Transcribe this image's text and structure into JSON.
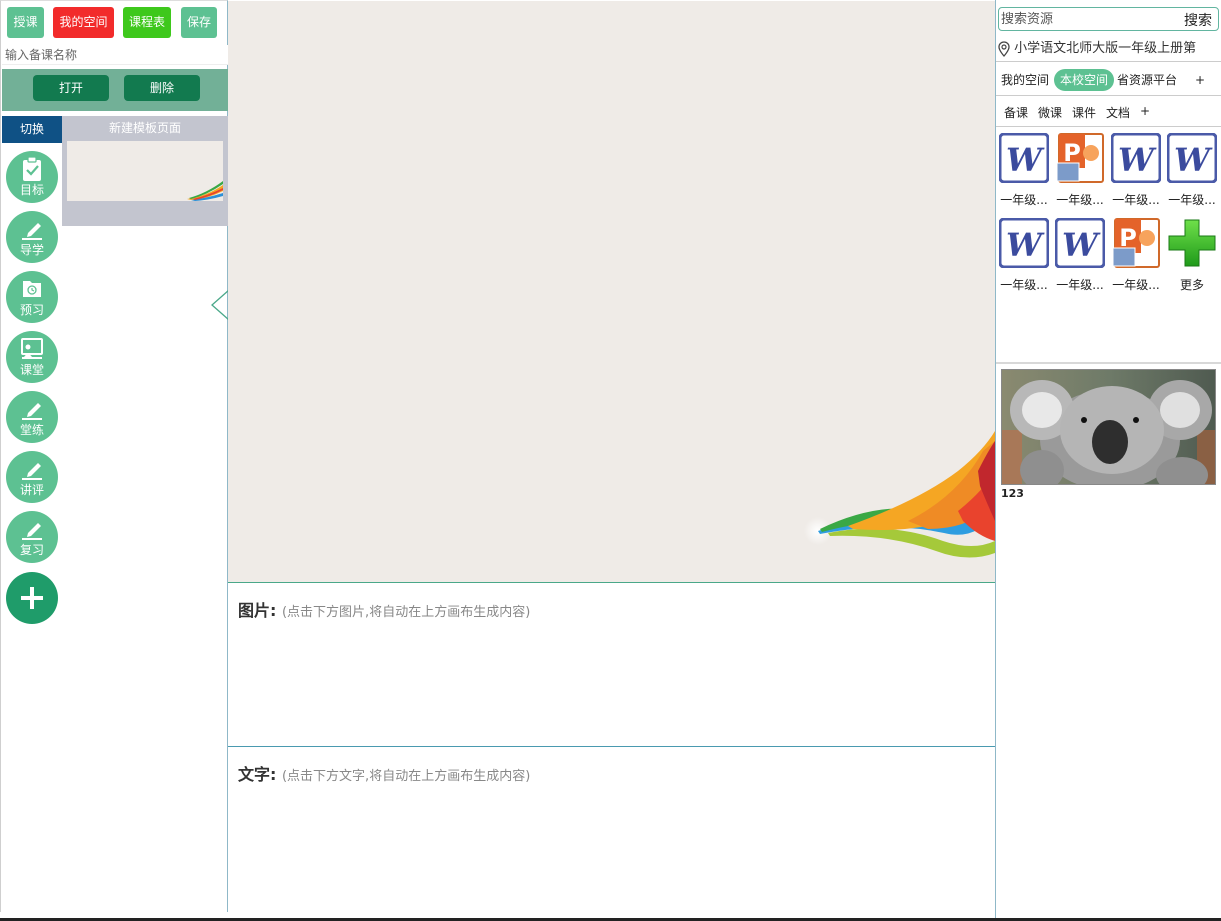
{
  "left": {
    "buttons": {
      "teach": "授课",
      "my_space": "我的空间",
      "schedule": "课程表",
      "save": "保存"
    },
    "button_colors": {
      "teach": "#5dc192",
      "my_space": "#f22b2b",
      "schedule": "#3ec81c",
      "save": "#5dc192"
    },
    "name_placeholder": "输入备课名称",
    "open": "打开",
    "delete": "删除",
    "switch": "切换",
    "template_title": "新建模板页面",
    "steps": [
      {
        "label": "目标",
        "icon": "clipboard-check-icon"
      },
      {
        "label": "导学",
        "icon": "pen-edit-icon"
      },
      {
        "label": "预习",
        "icon": "history-folder-icon"
      },
      {
        "label": "课堂",
        "icon": "classroom-board-icon"
      },
      {
        "label": "堂练",
        "icon": "pen-edit-icon"
      },
      {
        "label": "讲评",
        "icon": "pen-edit-icon"
      },
      {
        "label": "复习",
        "icon": "pen-edit-icon"
      }
    ]
  },
  "center": {
    "image_title": "图片:",
    "image_hint": "(点击下方图片,将自动在上方画布生成内容)",
    "text_title": "文字:",
    "text_hint": "(点击下方文字,将自动在上方画布生成内容)"
  },
  "right": {
    "search_placeholder": "搜索资源",
    "search_button": "搜索",
    "location": "小学语文北师大版一年级上册第",
    "space_tabs": [
      "我的空间",
      "本校空间",
      "省资源平台",
      "+"
    ],
    "active_space_tab": "本校空间",
    "type_tabs": [
      "备课",
      "微课",
      "课件",
      "文档",
      "+"
    ],
    "files": [
      {
        "type": "word",
        "name": "一年级..."
      },
      {
        "type": "ppt",
        "name": "一年级..."
      },
      {
        "type": "word",
        "name": "一年级..."
      },
      {
        "type": "word",
        "name": "一年级..."
      },
      {
        "type": "word",
        "name": "一年级..."
      },
      {
        "type": "word",
        "name": "一年级..."
      },
      {
        "type": "ppt",
        "name": "一年级..."
      },
      {
        "type": "more",
        "name": "更多"
      }
    ],
    "image_caption": "123"
  }
}
